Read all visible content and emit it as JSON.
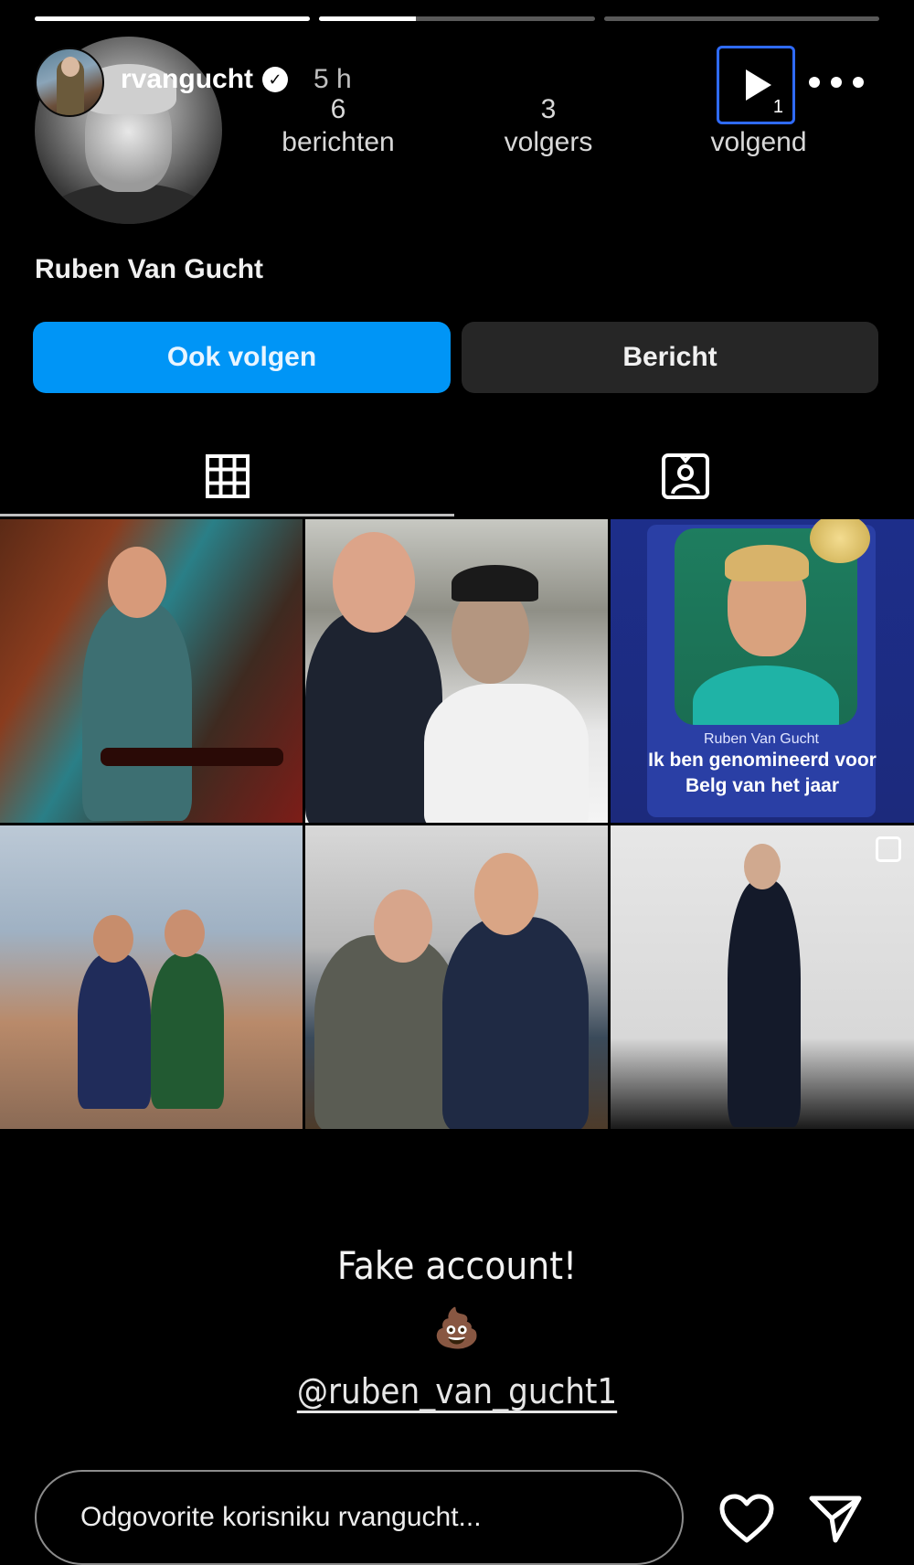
{
  "story": {
    "progress_segments": [
      1,
      0.35,
      0
    ],
    "user": {
      "username": "rvangucht",
      "verified": true,
      "time": "5 h"
    },
    "play_count": "1"
  },
  "profile": {
    "stats": [
      {
        "num": "6",
        "label": "berichten"
      },
      {
        "num": "3",
        "label": "volgers"
      },
      {
        "num": "",
        "label": "volgend"
      }
    ],
    "full_name": "Ruben Van Gucht",
    "follow_label": "Ook volgen",
    "message_label": "Bericht"
  },
  "tabs": [
    "grid-icon",
    "tagged-icon"
  ],
  "grid": {
    "card_name": "Ruben Van Gucht",
    "card_text": "Ik ben genomineerd voor Belg van het jaar"
  },
  "overlay": {
    "text": "Fake account!",
    "emoji": "💩",
    "mention": "@ruben_van_gucht1"
  },
  "reply": {
    "placeholder": "Odgovorite korisniku rvangucht..."
  },
  "colors": {
    "accent": "#0095f6",
    "focus_ring": "#2f6bff",
    "secondary_button": "#262626"
  }
}
